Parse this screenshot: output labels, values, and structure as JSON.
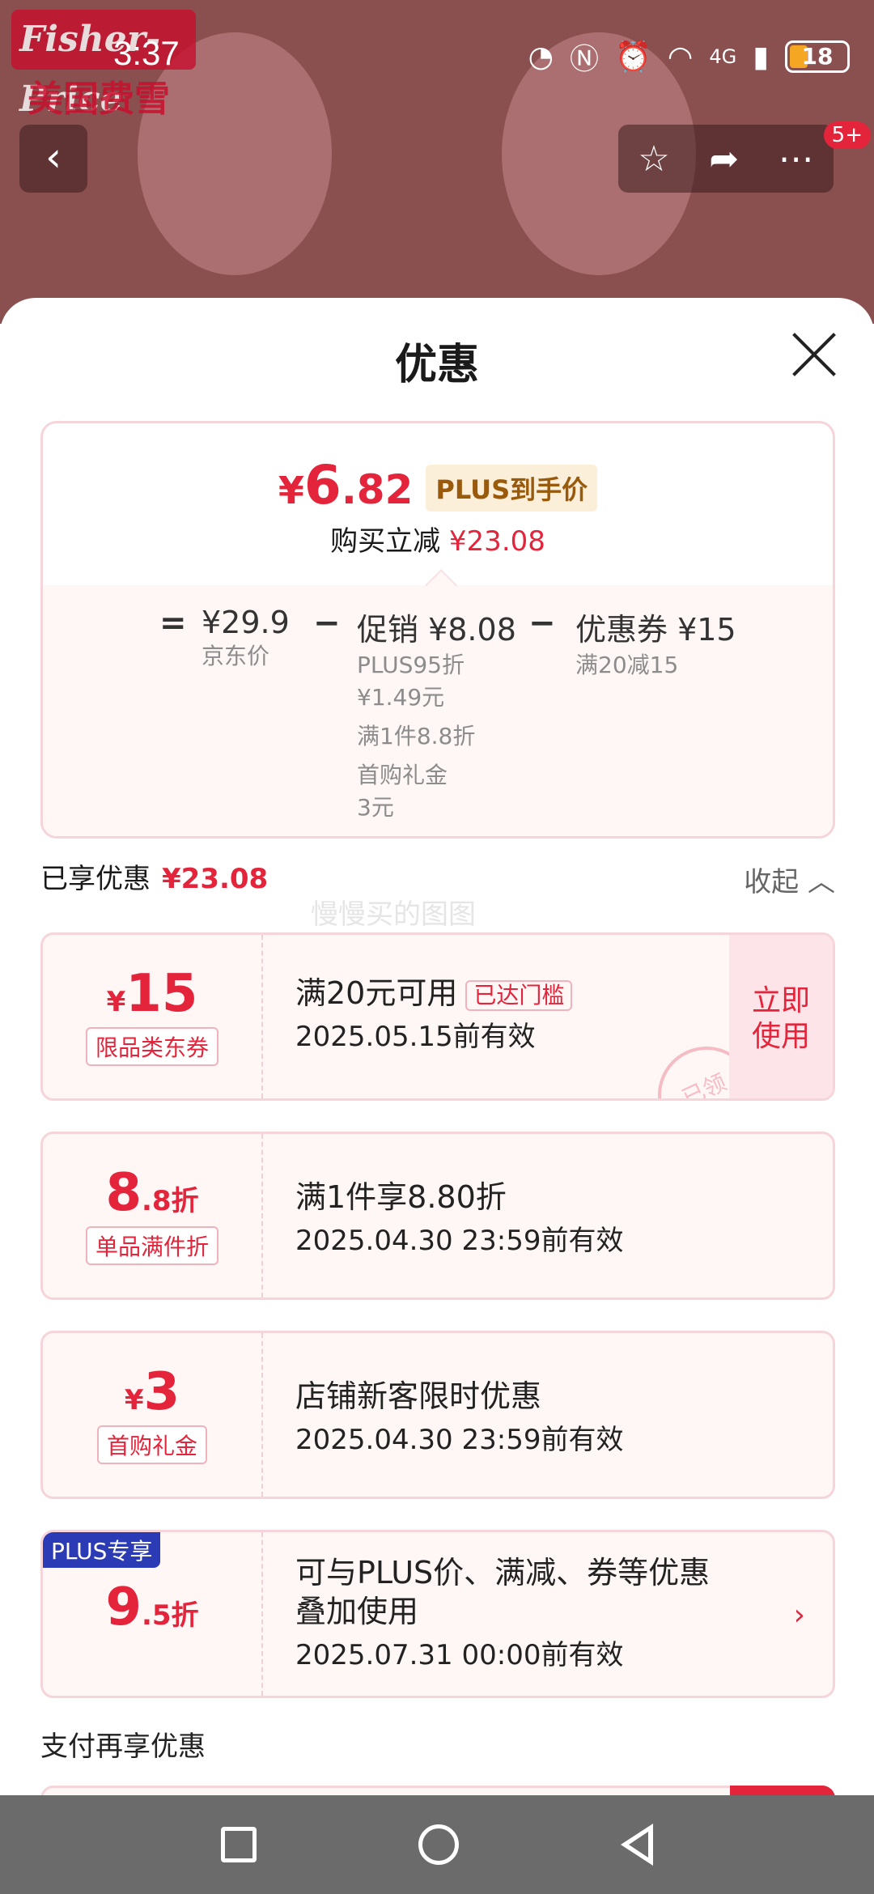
{
  "brand": {
    "logo_text": "Fisher-Price",
    "logo_cn": "美国费雪"
  },
  "status_bar": {
    "time": "3:37",
    "network": "4G",
    "battery": "18"
  },
  "top_nav": {
    "back_icon": "chevron-left-icon",
    "actions": [
      "star-icon",
      "share-icon",
      "more-icon"
    ],
    "badge": "5+"
  },
  "sheet": {
    "title": "优惠",
    "summary": {
      "currency": "¥",
      "price_int": "6",
      "price_dec": ".82",
      "price_tag": "PLUS到手价",
      "save_prefix": "购买立减",
      "save_amount": "¥23.08",
      "calc": {
        "equals": "=",
        "base_price": "¥29.9",
        "base_label": "京东价",
        "minus1": "−",
        "promo_title": "促销 ¥8.08",
        "promo_items": [
          "PLUS95折",
          "¥1.49元",
          "满1件8.8折",
          "首购礼金",
          "3元"
        ],
        "minus2": "−",
        "coupon_title": "优惠券 ¥15",
        "coupon_desc": "满20减15"
      }
    },
    "enjoyed_label": "已享优惠",
    "enjoyed_amount": "¥23.08",
    "collapse_label": "收起",
    "watermark": "慢慢买的图图",
    "coupons": [
      {
        "amount_prefix": "¥",
        "amount": "15",
        "type": "限品类东券",
        "main": "满20元可用",
        "tag": "已达门槛",
        "validity": "2025.05.15前有效",
        "button": "立即使用",
        "stamp": "已领"
      },
      {
        "amount": "8",
        "amount_suffix": ".8折",
        "type": "单品满件折",
        "main": "满1件享8.80折",
        "validity": "2025.04.30 23:59前有效"
      },
      {
        "amount_prefix": "¥",
        "amount": "3",
        "type": "首购礼金",
        "main": "店铺新客限时优惠",
        "validity": "2025.04.30 23:59前有效"
      },
      {
        "label": "PLUS专享",
        "amount": "9",
        "amount_suffix": ".5折",
        "main_line1": "可与PLUS价、满减、券等优惠",
        "main_line2": "叠加使用",
        "validity": "2025.07.31 00:00前有效"
      }
    ],
    "pay_title": "支付再享优惠"
  },
  "colors": {
    "accent_red": "#e3243b",
    "plus_blue": "#2b3bb5",
    "tag_gold": "#9a5a0c"
  }
}
